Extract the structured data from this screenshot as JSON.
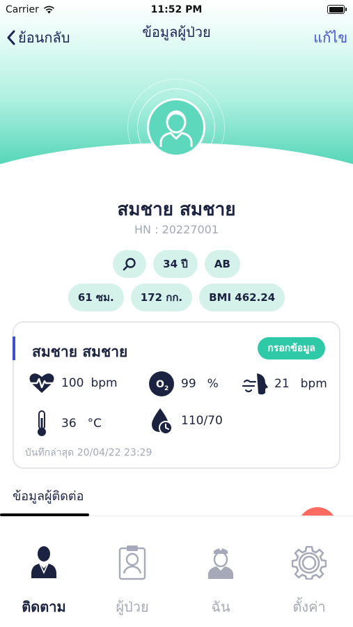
{
  "status_bar": {
    "carrier": "Carrier",
    "time": "11:52 PM"
  },
  "nav": {
    "back_label": "ย้อนกลับ",
    "title": "ข้อมูลผู้ป่วย",
    "edit_label": "แก้ไข"
  },
  "patient": {
    "name": "สมชาย สมชาย",
    "hn": "HN : 20227001",
    "chips_row1": [
      "34 ปี",
      "AB"
    ],
    "chips_row2": [
      "61 ซม.",
      "172 กก.",
      "BMI 462.24"
    ]
  },
  "vitals_card": {
    "name": "สมชาย สมชาย",
    "fill_button": "กรอกข้อมูล",
    "heart_rate": {
      "value": "100",
      "unit": "bpm",
      "icon": "heart-rate-icon"
    },
    "oxygen": {
      "value": "99",
      "unit": "%",
      "icon": "oxygen-icon"
    },
    "respiration": {
      "value": "21",
      "unit": "bpm",
      "icon": "respiration-icon"
    },
    "temperature": {
      "value": "36",
      "unit": "°C",
      "icon": "thermometer-icon"
    },
    "blood_pressure": {
      "value": "110/70",
      "icon": "blood-pressure-icon"
    },
    "last_updated": "บันทึกล่าสุด 20/04/22 23:29"
  },
  "contact_section": {
    "title": "ข้อมูลผู้ติดต่อ"
  },
  "tabbar": {
    "tabs": [
      {
        "label": "ติดตาม",
        "icon": "doctor-icon",
        "active": true
      },
      {
        "label": "ผู้ป่วย",
        "icon": "patient-card-icon",
        "active": false
      },
      {
        "label": "ฉัน",
        "icon": "nurse-icon",
        "active": false
      },
      {
        "label": "ตั้งค่า",
        "icon": "gear-icon",
        "active": false
      }
    ]
  },
  "colors": {
    "primary_dark": "#1b2340",
    "accent_blue": "#3e50cf",
    "teal": "#2fc9a8",
    "chip_bg": "#d4f2ea",
    "fab_red": "#ff6b61"
  }
}
